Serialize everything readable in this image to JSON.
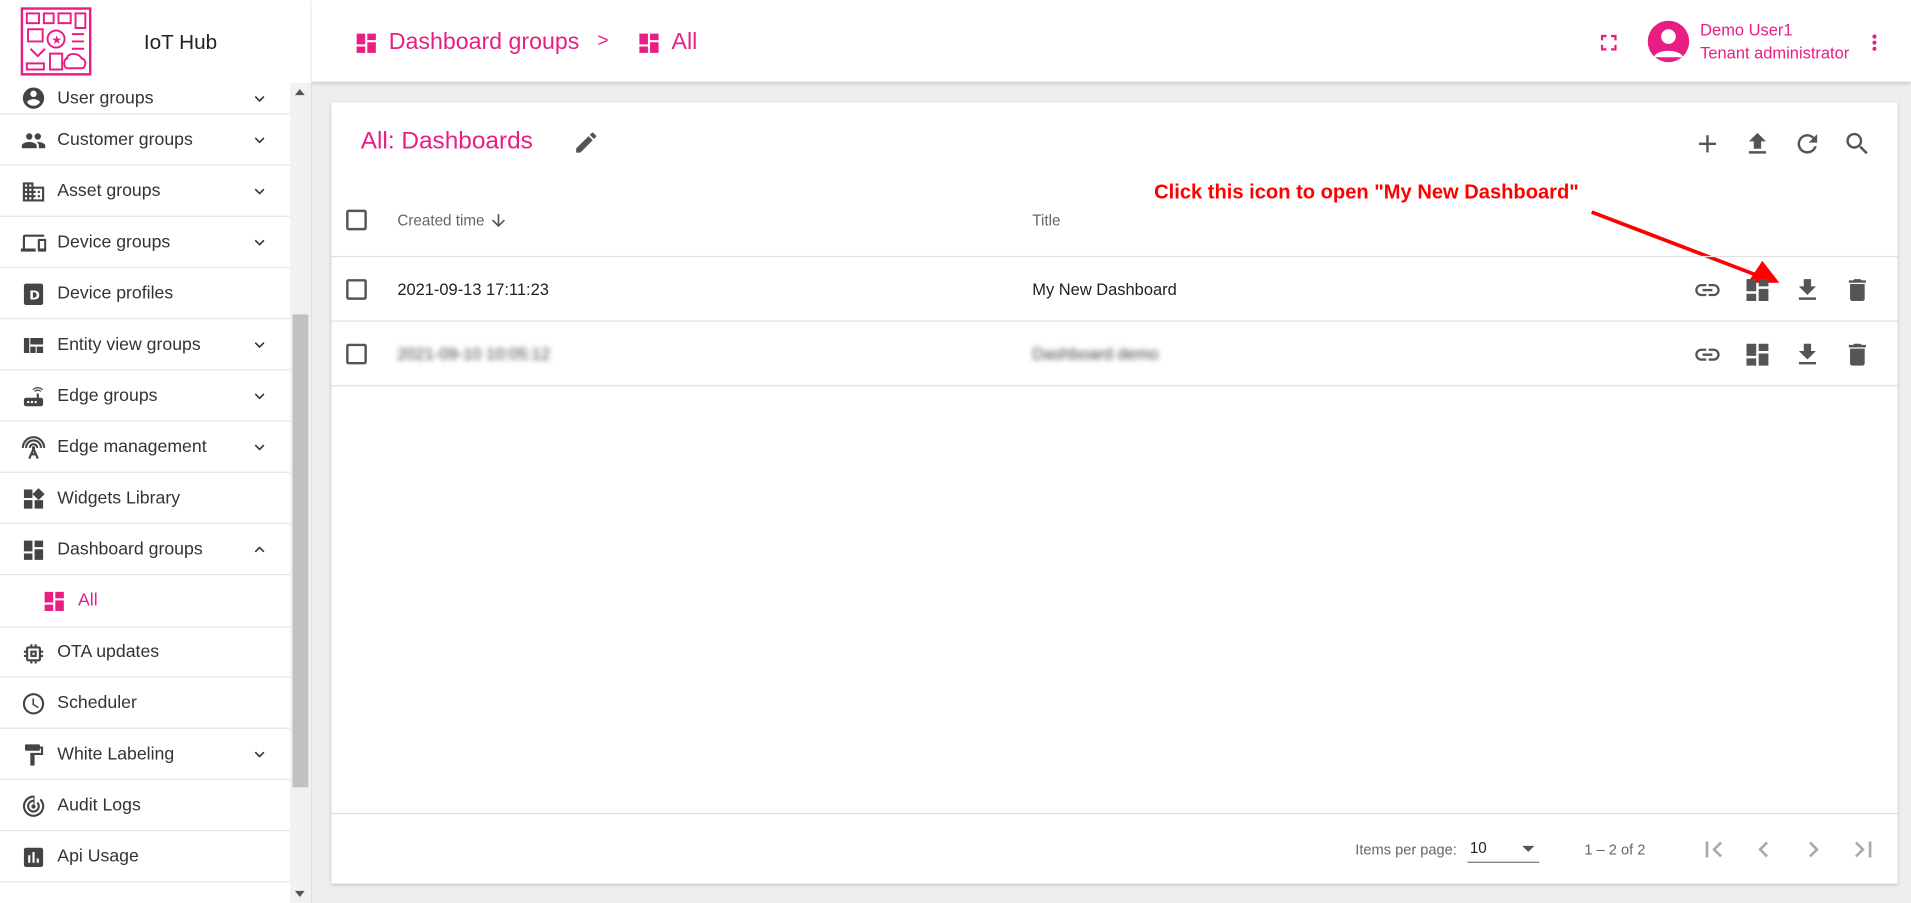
{
  "app": {
    "title": "IoT Hub",
    "accent_color": "#e91e84"
  },
  "sidebar": {
    "items": [
      {
        "label": "User groups",
        "icon": "account-circle-icon",
        "expandable": true
      },
      {
        "label": "Customer groups",
        "icon": "people-icon",
        "expandable": true
      },
      {
        "label": "Asset groups",
        "icon": "building-icon",
        "expandable": true
      },
      {
        "label": "Device groups",
        "icon": "devices-icon",
        "expandable": true
      },
      {
        "label": "Device profiles",
        "icon": "device-profile-icon",
        "expandable": false
      },
      {
        "label": "Entity view groups",
        "icon": "view-quilt-icon",
        "expandable": true
      },
      {
        "label": "Edge groups",
        "icon": "router-icon",
        "expandable": true
      },
      {
        "label": "Edge management",
        "icon": "antenna-icon",
        "expandable": true
      },
      {
        "label": "Widgets Library",
        "icon": "widgets-icon",
        "expandable": false
      },
      {
        "label": "Dashboard groups",
        "icon": "dashboard-icon",
        "expandable": true,
        "expanded": true
      },
      {
        "label": "All",
        "icon": "dashboard-icon",
        "sub": true,
        "selected": true
      },
      {
        "label": "OTA updates",
        "icon": "memory-chip-icon",
        "expandable": false
      },
      {
        "label": "Scheduler",
        "icon": "clock-icon",
        "expandable": false
      },
      {
        "label": "White Labeling",
        "icon": "paint-roller-icon",
        "expandable": true
      },
      {
        "label": "Audit Logs",
        "icon": "track-changes-icon",
        "expandable": false
      },
      {
        "label": "Api Usage",
        "icon": "bar-chart-icon",
        "expandable": false
      }
    ]
  },
  "header": {
    "breadcrumbs": [
      {
        "label": "Dashboard groups",
        "icon": "dashboard-icon"
      },
      {
        "label": "All",
        "icon": "dashboard-icon"
      }
    ],
    "separator": ">",
    "user": {
      "name": "Demo User1",
      "role": "Tenant administrator"
    }
  },
  "main": {
    "title": "All: Dashboards",
    "toolbar": [
      "add-icon",
      "upload-icon",
      "refresh-icon",
      "search-icon"
    ],
    "columns": {
      "created": "Created time",
      "title": "Title"
    },
    "rows": [
      {
        "created": "2021-09-13 17:11:23",
        "title": "My New Dashboard",
        "blurred": false
      },
      {
        "created": "2021-09-10 10:05:12",
        "title": "Dashboard demo",
        "blurred": true
      }
    ],
    "annotation": "Click this icon to open \"My New Dashboard\"",
    "annotation_color": "#ff0000"
  },
  "pagination": {
    "items_per_page_label": "Items per page:",
    "items_per_page": "10",
    "range": "1 – 2 of 2"
  }
}
